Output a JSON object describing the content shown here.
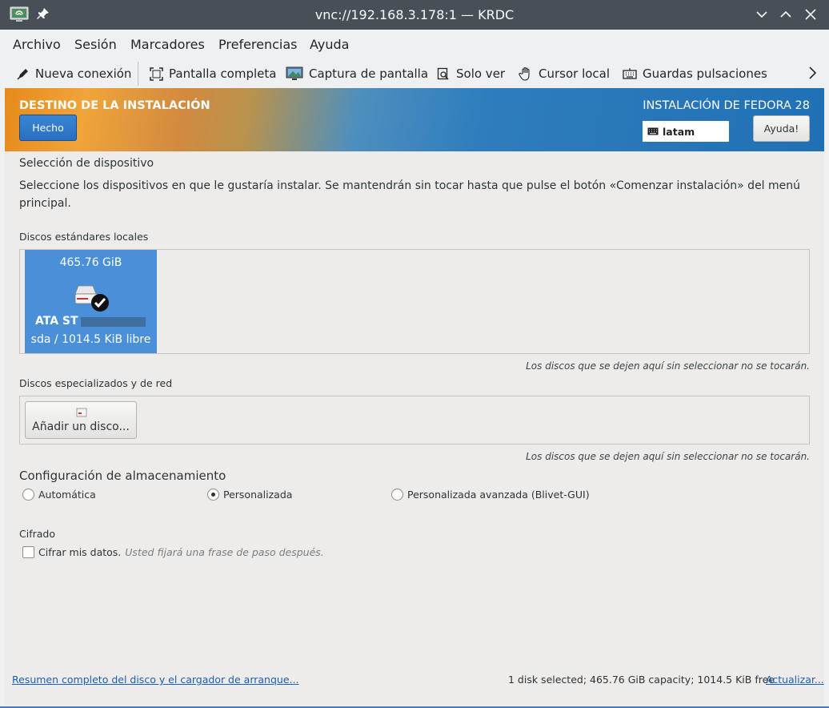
{
  "window": {
    "title": "vnc://192.168.3.178:1 — KRDC"
  },
  "menu": {
    "items": [
      "Archivo",
      "Sesión",
      "Marcadores",
      "Preferencias",
      "Ayuda"
    ]
  },
  "toolbar": {
    "new_connection": "Nueva conexión",
    "fullscreen": "Pantalla completa",
    "screenshot": "Captura de pantalla",
    "view_only": "Solo ver",
    "local_cursor": "Cursor local",
    "grab_keys": "Guardas pulsaciones"
  },
  "header": {
    "title": "DESTINO DE LA INSTALACIÓN",
    "done_label": "Hecho",
    "product": "INSTALACIÓN DE FEDORA 28",
    "keyboard_layout": "latam",
    "help_label": "Ayuda!"
  },
  "device_selection": {
    "title": "Selección de dispositivo",
    "description": "Seleccione los dispositivos en que le gustaría instalar. Se mantendrán sin tocar hasta que pulse el botón «Comenzar instalación» del menú principal."
  },
  "local_disks": {
    "title": "Discos estándares locales",
    "disk": {
      "size": "465.76 GiB",
      "name": "ATA ST",
      "description": "sda  /  1014.5 KiB libre"
    },
    "hint": "Los discos que se dejen aquí sin seleccionar no se tocarán."
  },
  "network_disks": {
    "title": "Discos especializados y de red",
    "add_label": "Añadir un disco...",
    "hint": "Los discos que se dejen aquí sin seleccionar no se tocarán."
  },
  "storage_config": {
    "title": "Configuración de almacenamiento",
    "options": [
      "Automática",
      "Personalizada",
      "Personalizada avanzada (Blivet-GUI)"
    ],
    "selected": "Personalizada"
  },
  "encryption": {
    "title": "Cifrado",
    "checkbox_label": "Cifrar mis datos.",
    "checkbox_hint": "Usted fijará una frase de paso después."
  },
  "footer": {
    "summary_link": "Resumen completo del disco y el cargador de arranque...",
    "status": "1 disk selected; 465.76 GiB capacity; 1014.5 KiB free",
    "refresh_link": "Actualizar..."
  },
  "colors": {
    "titlebar": "#475057",
    "selected_disk": "#4a90d9",
    "link": "#1a5fb4"
  }
}
